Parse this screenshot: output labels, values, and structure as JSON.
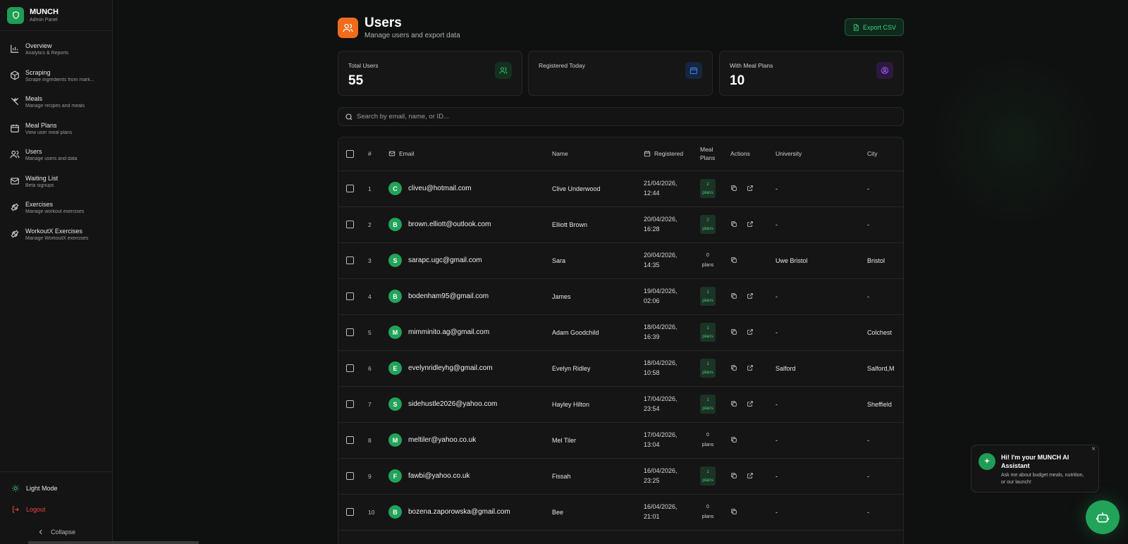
{
  "brand": {
    "title": "MUNCH",
    "subtitle": "Admin Panel",
    "color": "#1f9d55"
  },
  "sidebar": {
    "items": [
      {
        "label": "Overview",
        "desc": "Analytics & Reports",
        "icon": "bar-chart-icon"
      },
      {
        "label": "Scraping",
        "desc": "Scrape ingredients from mark...",
        "icon": "package-icon"
      },
      {
        "label": "Meals",
        "desc": "Manage recipes and meals",
        "icon": "utensils-icon"
      },
      {
        "label": "Meal Plans",
        "desc": "View user meal plans",
        "icon": "calendar-icon"
      },
      {
        "label": "Users",
        "desc": "Manage users and data",
        "icon": "users-icon"
      },
      {
        "label": "Waiting List",
        "desc": "Beta signups",
        "icon": "mail-icon"
      },
      {
        "label": "Exercises",
        "desc": "Manage workout exercises",
        "icon": "dumbbell-icon"
      },
      {
        "label": "WorkoutX Exercises",
        "desc": "Manage WorkoutX exercises",
        "icon": "dumbbell-icon"
      }
    ],
    "light_mode": "Light Mode",
    "logout": "Logout",
    "collapse": "Collapse"
  },
  "header": {
    "title": "Users",
    "subtitle": "Manage users and export data",
    "export_label": "Export CSV",
    "accent": "#f26b1d"
  },
  "stats": [
    {
      "label": "Total Users",
      "value": "55",
      "icon": "users-icon",
      "color": "#2fbf71"
    },
    {
      "label": "Registered Today",
      "value": "",
      "icon": "calendar-icon",
      "color": "#3b82f6"
    },
    {
      "label": "With Meal Plans",
      "value": "10",
      "icon": "user-circle-icon",
      "color": "#a855f7"
    }
  ],
  "search": {
    "placeholder": "Search by email, name, or ID..."
  },
  "table": {
    "headers": {
      "num": "#",
      "email": "Email",
      "name": "Name",
      "registered": "Registered",
      "meal_plans_1": "Meal",
      "meal_plans_2": "Plans",
      "actions": "Actions",
      "university": "University",
      "city": "City"
    },
    "rows": [
      {
        "num": "1",
        "initial": "C",
        "email": "cliveu@hotmail.com",
        "name": "Clive Underwood",
        "date": "21/04/2026,",
        "time": "12:44",
        "plans_n": "2",
        "plans_w": "plans",
        "has_plans": true,
        "university": "-",
        "city": "-"
      },
      {
        "num": "2",
        "initial": "B",
        "email": "brown.elliott@outlook.com",
        "name": "Elliott Brown",
        "date": "20/04/2026,",
        "time": "16:28",
        "plans_n": "2",
        "plans_w": "plans",
        "has_plans": true,
        "university": "-",
        "city": "-"
      },
      {
        "num": "3",
        "initial": "S",
        "email": "sarapc.ugc@gmail.com",
        "name": "Sara",
        "date": "20/04/2026,",
        "time": "14:35",
        "plans_n": "0",
        "plans_w": "plans",
        "has_plans": false,
        "university": "Uwe Bristol",
        "city": "Bristol"
      },
      {
        "num": "4",
        "initial": "B",
        "email": "bodenham95@gmail.com",
        "name": "James",
        "date": "19/04/2026,",
        "time": "02:06",
        "plans_n": "1",
        "plans_w": "plans",
        "has_plans": true,
        "university": "-",
        "city": "-"
      },
      {
        "num": "5",
        "initial": "M",
        "email": "mimminito.ag@gmail.com",
        "name": "Adam Goodchild",
        "date": "18/04/2026,",
        "time": "16:39",
        "plans_n": "1",
        "plans_w": "plans",
        "has_plans": true,
        "university": "-",
        "city": "Colchest"
      },
      {
        "num": "6",
        "initial": "E",
        "email": "evelynridleyhg@gmail.com",
        "name": "Evelyn Ridley",
        "date": "18/04/2026,",
        "time": "10:58",
        "plans_n": "1",
        "plans_w": "plans",
        "has_plans": true,
        "university": "Salford",
        "city": "Salford,M"
      },
      {
        "num": "7",
        "initial": "S",
        "email": "sidehustle2026@yahoo.com",
        "name": "Hayley Hilton",
        "date": "17/04/2026,",
        "time": "23:54",
        "plans_n": "1",
        "plans_w": "plans",
        "has_plans": true,
        "university": "-",
        "city": "Sheffield"
      },
      {
        "num": "8",
        "initial": "M",
        "email": "meltiler@yahoo.co.uk",
        "name": "Mel Tiler",
        "date": "17/04/2026,",
        "time": "13:04",
        "plans_n": "0",
        "plans_w": "plans",
        "has_plans": false,
        "university": "-",
        "city": "-"
      },
      {
        "num": "9",
        "initial": "F",
        "email": "fawbi@yahoo.co.uk",
        "name": "Fissah",
        "date": "16/04/2026,",
        "time": "23:25",
        "plans_n": "1",
        "plans_w": "plans",
        "has_plans": true,
        "university": "-",
        "city": "-"
      },
      {
        "num": "10",
        "initial": "B",
        "email": "bozena.zaporowska@gmail.com",
        "name": "Bee",
        "date": "16/04/2026,",
        "time": "21:01",
        "plans_n": "0",
        "plans_w": "plans",
        "has_plans": false,
        "university": "-",
        "city": "-"
      }
    ]
  },
  "chat": {
    "title": "Hi! I'm your MUNCH AI Assistant",
    "message": "Ask me about budget meals, nutrition, or our launch!",
    "close": "×"
  }
}
